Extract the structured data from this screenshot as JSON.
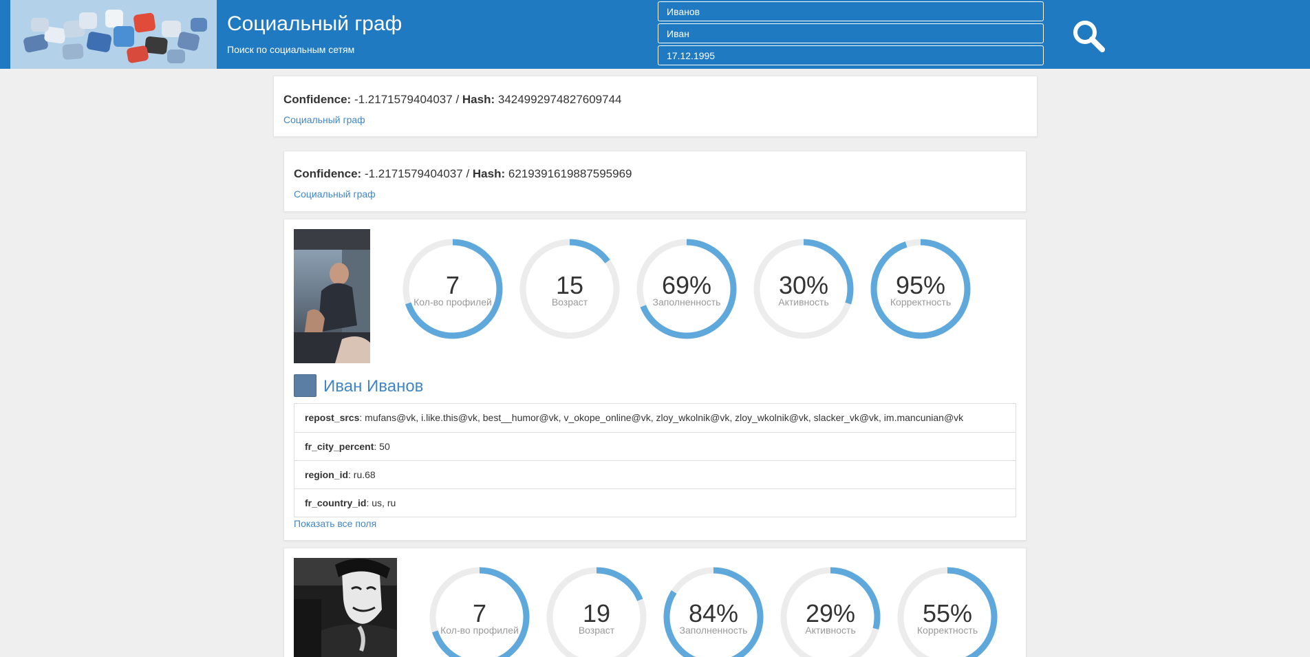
{
  "header": {
    "title": "Социальный граф",
    "subtitle": "Поиск по социальным сетям",
    "search": {
      "last_name": "Иванов",
      "first_name": "Иван",
      "birth_date": "17.12.1995"
    }
  },
  "results": [
    {
      "confidence_label": "Confidence:",
      "confidence_value": "-1.2171579404037",
      "separator": " / ",
      "hash_label": "Hash:",
      "hash_value": "3424992974827609744",
      "link": "Социальный граф"
    },
    {
      "confidence_label": "Confidence:",
      "confidence_value": "-1.2171579404037",
      "separator": " / ",
      "hash_label": "Hash:",
      "hash_value": "6219391619887595969",
      "link": "Социальный граф"
    }
  ],
  "profiles": [
    {
      "name": "Иван Иванов",
      "network_icon": "vk-icon",
      "stats": [
        {
          "value": "7",
          "label": "Кол-во профилей",
          "fraction": 0.7
        },
        {
          "value": "15",
          "label": "Возраст",
          "fraction": 0.15
        },
        {
          "value": "69%",
          "label": "Заполненность",
          "fraction": 0.69
        },
        {
          "value": "30%",
          "label": "Активность",
          "fraction": 0.3
        },
        {
          "value": "95%",
          "label": "Корректность",
          "fraction": 0.95
        }
      ],
      "fields": [
        {
          "key": "repost_srcs",
          "value": "mufans@vk, i.like.this@vk, best__humor@vk, v_okope_online@vk, zloy_wkolnik@vk, zloy_wkolnik@vk, slacker_vk@vk, im.mancunian@vk"
        },
        {
          "key": "fr_city_percent",
          "value": "50"
        },
        {
          "key": "region_id",
          "value": "ru.68"
        },
        {
          "key": "fr_country_id",
          "value": "us, ru"
        }
      ],
      "show_all_link": "Показать все поля"
    },
    {
      "stats": [
        {
          "value": "7",
          "label": "Кол-во профилей",
          "fraction": 0.7
        },
        {
          "value": "19",
          "label": "Возраст",
          "fraction": 0.19
        },
        {
          "value": "84%",
          "label": "Заполненность",
          "fraction": 0.84
        },
        {
          "value": "29%",
          "label": "Активность",
          "fraction": 0.29
        },
        {
          "value": "55%",
          "label": "Корректность",
          "fraction": 0.55
        }
      ]
    }
  ],
  "colors": {
    "header_bg": "#1f7ac2",
    "gauge_fill": "#5fa8dc",
    "gauge_track": "#ececec",
    "link": "#3f86c6"
  }
}
